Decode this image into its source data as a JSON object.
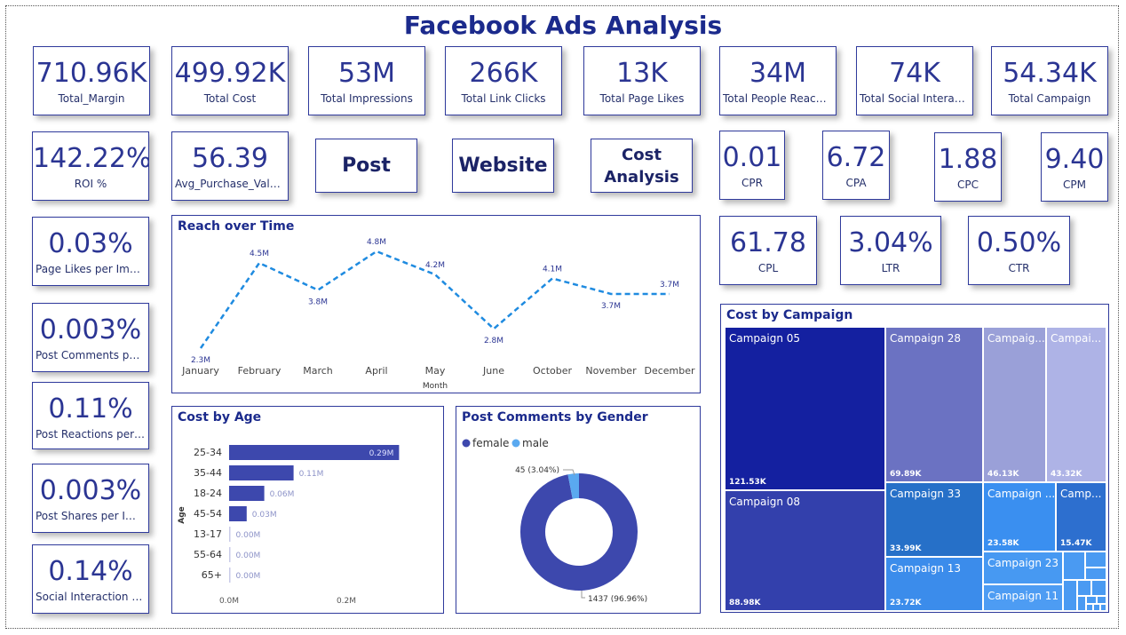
{
  "title": "Facebook Ads Analysis",
  "kpi_row1": [
    {
      "value": "710.96K",
      "label": "Total_Margin"
    },
    {
      "value": "499.92K",
      "label": "Total Cost"
    },
    {
      "value": "53M",
      "label": "Total Impressions"
    },
    {
      "value": "266K",
      "label": "Total Link Clicks"
    },
    {
      "value": "13K",
      "label": "Total Page Likes"
    },
    {
      "value": "34M",
      "label": "Total People Reached"
    },
    {
      "value": "74K",
      "label": "Total Social Interact..."
    },
    {
      "value": "54.34K",
      "label": "Total Campaign"
    }
  ],
  "kpi_row2": [
    {
      "value": "142.22%",
      "label": "ROI %"
    },
    {
      "value": "56.39",
      "label": "Avg_Purchase_Value_"
    }
  ],
  "nav_buttons": {
    "post": "Post",
    "website": "Website",
    "cost_line1": "Cost",
    "cost_line2": "Analysis"
  },
  "ratio_cards": [
    {
      "value": "0.01",
      "label": "CPR"
    },
    {
      "value": "6.72",
      "label": "CPA"
    },
    {
      "value": "1.88",
      "label": "CPC"
    },
    {
      "value": "9.40",
      "label": "CPM"
    },
    {
      "value": "61.78",
      "label": "CPL"
    },
    {
      "value": "3.04%",
      "label": "LTR"
    },
    {
      "value": "0.50%",
      "label": "CTR"
    }
  ],
  "left_cards": [
    {
      "value": "0.03%",
      "label": "Page Likes per Impr..."
    },
    {
      "value": "0.003%",
      "label": "Post Comments per..."
    },
    {
      "value": "0.11%",
      "label": "Post Reactions per I..."
    },
    {
      "value": "0.003%",
      "label": "Post Shares per Im..."
    },
    {
      "value": "0.14%",
      "label": "Social Interaction p..."
    }
  ],
  "reach": {
    "title": "Reach over Time",
    "xlabel": "Month",
    "color": "#1f8be0",
    "chart_data": {
      "type": "line",
      "title": "Reach over Time",
      "xlabel": "Month",
      "ylabel": "",
      "categories": [
        "January",
        "February",
        "March",
        "April",
        "May",
        "June",
        "October",
        "November",
        "December"
      ],
      "values": [
        2.3,
        4.5,
        3.8,
        4.8,
        4.2,
        2.8,
        4.1,
        3.7,
        3.7
      ],
      "labels": [
        "2.3M",
        "4.5M",
        "3.8M",
        "4.8M",
        "4.2M",
        "2.8M",
        "4.1M",
        "3.7M",
        "3.7M"
      ]
    }
  },
  "age": {
    "title": "Cost by Age",
    "ylabel": "Age",
    "ticks": [
      "0.0M",
      "0.2M"
    ],
    "chart_data": {
      "type": "bar",
      "title": "Cost by Age",
      "ylabel": "Age",
      "xlim": [
        0,
        0.3
      ],
      "categories": [
        "25-34",
        "35-44",
        "18-24",
        "45-54",
        "13-17",
        "55-64",
        "65+"
      ],
      "values": [
        0.29,
        0.11,
        0.06,
        0.03,
        0.0,
        0.0,
        0.0
      ],
      "labels": [
        "0.29M",
        "0.11M",
        "0.06M",
        "0.03M",
        "0.00M",
        "0.00M",
        "0.00M"
      ]
    }
  },
  "gender": {
    "title": "Post Comments by Gender",
    "legend": [
      "female",
      "male"
    ],
    "colors": [
      "#3d48ad",
      "#5aa9f0"
    ],
    "chart_data": {
      "type": "pie",
      "title": "Post Comments by Gender",
      "categories": [
        "female",
        "male"
      ],
      "values": [
        1437,
        45
      ],
      "labels": [
        "1437 (96.96%)",
        "45 (3.04%)"
      ]
    }
  },
  "campaign": {
    "title": "Cost by Campaign",
    "cells": [
      {
        "name": "Campaign 05",
        "value": "121.53K",
        "color": "#1420a0"
      },
      {
        "name": "Campaign 08",
        "value": "88.98K",
        "color": "#3340ac"
      },
      {
        "name": "Campaign 28",
        "value": "69.89K",
        "color": "#6b72c2"
      },
      {
        "name": "Campaig...",
        "value": "46.13K",
        "color": "#9aa0d8"
      },
      {
        "name": "Campai...",
        "value": "43.32K",
        "color": "#aeb3e6"
      },
      {
        "name": "Campaign 33",
        "value": "33.99K",
        "color": "#2670c8"
      },
      {
        "name": "Campaign ...",
        "value": "23.58K",
        "color": "#3a8ff0"
      },
      {
        "name": "Camp...",
        "value": "15.47K",
        "color": "#2d6fcf"
      },
      {
        "name": "Campaign 13",
        "value": "23.72K",
        "color": "#3b8ceb"
      },
      {
        "name": "Campaign 23",
        "value": "",
        "color": "#4799f2"
      },
      {
        "name": "Campaign 11",
        "value": "",
        "color": "#4d9cf3"
      }
    ],
    "small_color": "#4a9af2"
  }
}
